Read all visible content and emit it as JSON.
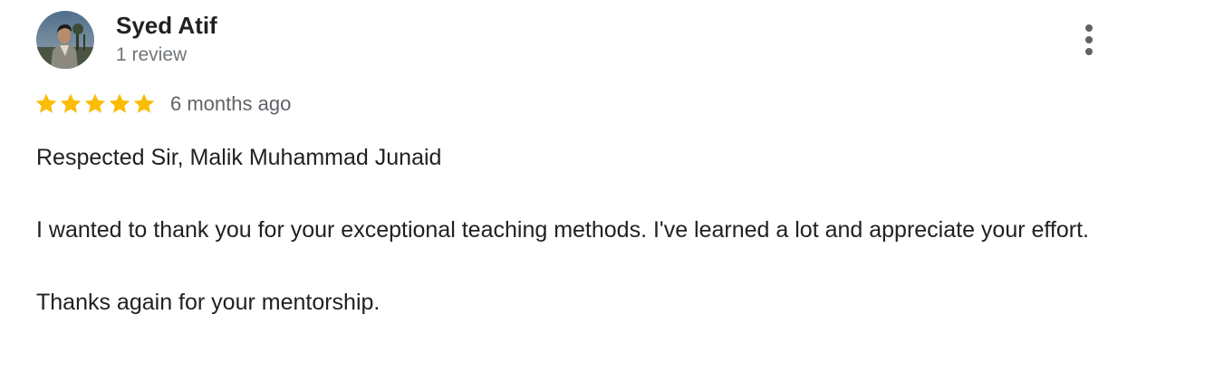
{
  "reviewer": {
    "name": "Syed Atif",
    "review_count": "1 review"
  },
  "review": {
    "rating": 5,
    "rating_max": 5,
    "date": "6 months ago",
    "paragraphs": [
      "Respected Sir, Malik Muhammad Junaid",
      "I wanted to thank you for your exceptional teaching methods. I've learned a lot and appreciate your effort.",
      "Thanks again for your mentorship."
    ]
  },
  "icons": {
    "menu": "more-vert-icon",
    "star": "star-icon",
    "avatar": "profile-photo"
  },
  "colors": {
    "star": "#fbbc04",
    "name": "#202124",
    "secondary_text": "#70757a",
    "body_text": "#202124",
    "menu_dots": "#5f6368"
  }
}
